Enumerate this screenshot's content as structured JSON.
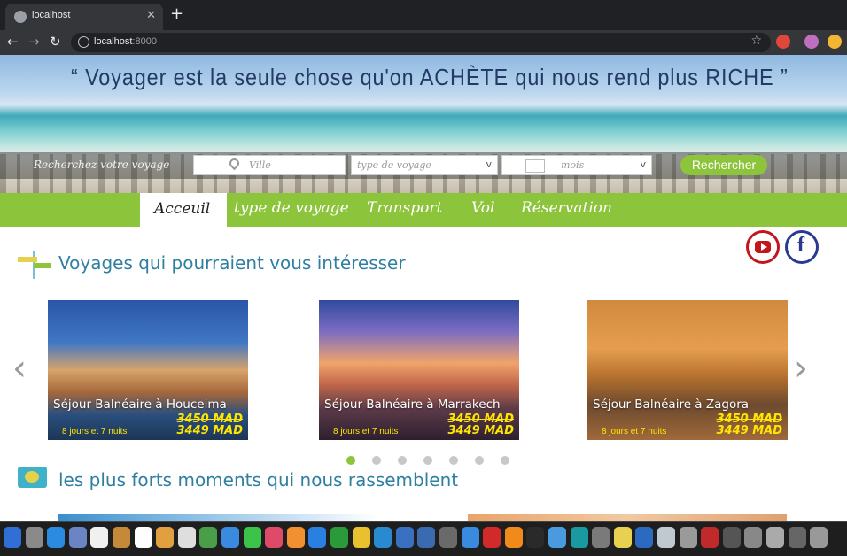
{
  "browser": {
    "tab_title": "localhost",
    "url_host": "localhost",
    "url_port": ":8000",
    "new_tab": "+",
    "close": "✕"
  },
  "hero": {
    "quote": "“ Voyager est la seule chose qu'on ACHÈTE qui nous rend plus RICHE ”",
    "search_label": "Recherchez votre voyage",
    "ville_placeholder": "Ville",
    "type_placeholder": "type de voyage",
    "mois_placeholder": "mois",
    "search_button": "Rechercher"
  },
  "nav": {
    "items": [
      "Acceuil",
      "type de voyage",
      "Transport",
      "Vol",
      "Réservation"
    ],
    "active": "Acceuil"
  },
  "sections": {
    "interest_title": "Voyages qui pourraient vous intéresser",
    "moments_title": "les plus forts moments qui nous rassemblent"
  },
  "cards": [
    {
      "title": "Séjour Balnéaire à Houceima",
      "old_price": "3450 MAD",
      "new_price": "3449 MAD",
      "duration": "8 jours et 7 nuits"
    },
    {
      "title": "Séjour Balnéaire à Marrakech",
      "old_price": "3450 MAD",
      "new_price": "3449 MAD",
      "duration": "8 jours et 7 nuits"
    },
    {
      "title": "Séjour Balnéaire à Zagora",
      "old_price": "3450 MAD",
      "new_price": "3449 MAD",
      "duration": "8 jours et 7 nuits"
    }
  ],
  "carousel": {
    "prev": "‹",
    "next": "›",
    "active_dot": 1,
    "dot_count": 7
  },
  "social": {
    "facebook": "f"
  },
  "colors": {
    "accent_green": "#8cc43c",
    "heading_blue": "#2f7fa0",
    "price_yellow": "#ffe600"
  }
}
